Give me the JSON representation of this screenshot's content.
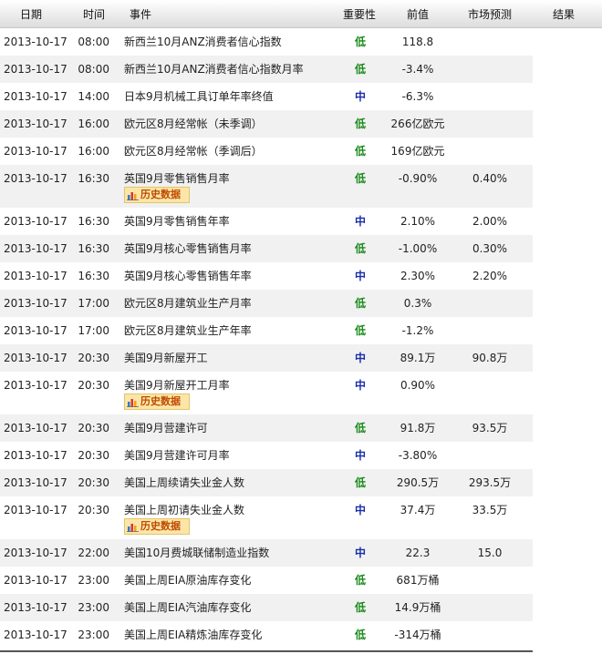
{
  "columns": {
    "date": "日期",
    "time": "时间",
    "event": "事件",
    "importance": "重要性",
    "previous": "前值",
    "forecast": "市场预测",
    "result": "结果"
  },
  "history_label": "历史数据",
  "rows": [
    {
      "date": "2013-10-17",
      "time": "08:00",
      "event": "新西兰10月ANZ消费者信心指数",
      "importance": "低",
      "level": "low",
      "previous": "118.8",
      "forecast": "",
      "result": "",
      "history": false
    },
    {
      "date": "2013-10-17",
      "time": "08:00",
      "event": "新西兰10月ANZ消费者信心指数月率",
      "importance": "低",
      "level": "low",
      "previous": "-3.4%",
      "forecast": "",
      "result": "",
      "history": false
    },
    {
      "date": "2013-10-17",
      "time": "14:00",
      "event": "日本9月机械工具订单年率终值",
      "importance": "中",
      "level": "mid",
      "previous": "-6.3%",
      "forecast": "",
      "result": "",
      "history": false
    },
    {
      "date": "2013-10-17",
      "time": "16:00",
      "event": "欧元区8月经常帐（未季调）",
      "importance": "低",
      "level": "low",
      "previous": "266亿欧元",
      "forecast": "",
      "result": "",
      "history": false
    },
    {
      "date": "2013-10-17",
      "time": "16:00",
      "event": "欧元区8月经常帐（季调后）",
      "importance": "低",
      "level": "low",
      "previous": "169亿欧元",
      "forecast": "",
      "result": "",
      "history": false
    },
    {
      "date": "2013-10-17",
      "time": "16:30",
      "event": "英国9月零售销售月率",
      "importance": "低",
      "level": "low",
      "previous": "-0.90%",
      "forecast": "0.40%",
      "result": "",
      "history": true
    },
    {
      "date": "2013-10-17",
      "time": "16:30",
      "event": "英国9月零售销售年率",
      "importance": "中",
      "level": "mid",
      "previous": "2.10%",
      "forecast": "2.00%",
      "result": "",
      "history": false
    },
    {
      "date": "2013-10-17",
      "time": "16:30",
      "event": "英国9月核心零售销售月率",
      "importance": "低",
      "level": "low",
      "previous": "-1.00%",
      "forecast": "0.30%",
      "result": "",
      "history": false
    },
    {
      "date": "2013-10-17",
      "time": "16:30",
      "event": "英国9月核心零售销售年率",
      "importance": "中",
      "level": "mid",
      "previous": "2.30%",
      "forecast": "2.20%",
      "result": "",
      "history": false
    },
    {
      "date": "2013-10-17",
      "time": "17:00",
      "event": "欧元区8月建筑业生产月率",
      "importance": "低",
      "level": "low",
      "previous": "0.3%",
      "forecast": "",
      "result": "",
      "history": false
    },
    {
      "date": "2013-10-17",
      "time": "17:00",
      "event": "欧元区8月建筑业生产年率",
      "importance": "低",
      "level": "low",
      "previous": "-1.2%",
      "forecast": "",
      "result": "",
      "history": false
    },
    {
      "date": "2013-10-17",
      "time": "20:30",
      "event": "美国9月新屋开工",
      "importance": "中",
      "level": "mid",
      "previous": "89.1万",
      "forecast": "90.8万",
      "result": "",
      "history": false
    },
    {
      "date": "2013-10-17",
      "time": "20:30",
      "event": "美国9月新屋开工月率",
      "importance": "中",
      "level": "mid",
      "previous": "0.90%",
      "forecast": "",
      "result": "",
      "history": true
    },
    {
      "date": "2013-10-17",
      "time": "20:30",
      "event": "美国9月营建许可",
      "importance": "低",
      "level": "low",
      "previous": "91.8万",
      "forecast": "93.5万",
      "result": "",
      "history": false
    },
    {
      "date": "2013-10-17",
      "time": "20:30",
      "event": "美国9月营建许可月率",
      "importance": "中",
      "level": "mid",
      "previous": "-3.80%",
      "forecast": "",
      "result": "",
      "history": false
    },
    {
      "date": "2013-10-17",
      "time": "20:30",
      "event": "美国上周续请失业金人数",
      "importance": "低",
      "level": "low",
      "previous": "290.5万",
      "forecast": "293.5万",
      "result": "",
      "history": false
    },
    {
      "date": "2013-10-17",
      "time": "20:30",
      "event": "美国上周初请失业金人数",
      "importance": "中",
      "level": "mid",
      "previous": "37.4万",
      "forecast": "33.5万",
      "result": "",
      "history": true
    },
    {
      "date": "2013-10-17",
      "time": "22:00",
      "event": "美国10月费城联储制造业指数",
      "importance": "中",
      "level": "mid",
      "previous": "22.3",
      "forecast": "15.0",
      "result": "",
      "history": false
    },
    {
      "date": "2013-10-17",
      "time": "23:00",
      "event": "美国上周EIA原油库存变化",
      "importance": "低",
      "level": "low",
      "previous": "681万桶",
      "forecast": "",
      "result": "",
      "history": false
    },
    {
      "date": "2013-10-17",
      "time": "23:00",
      "event": "美国上周EIA汽油库存变化",
      "importance": "低",
      "level": "low",
      "previous": "14.9万桶",
      "forecast": "",
      "result": "",
      "history": false
    },
    {
      "date": "2013-10-17",
      "time": "23:00",
      "event": "美国上周EIA精炼油库存变化",
      "importance": "低",
      "level": "low",
      "previous": "-314万桶",
      "forecast": "",
      "result": "",
      "history": false
    }
  ],
  "colors": {
    "importance_low": "#1a8a1a",
    "importance_mid": "#1a2faa",
    "row_alt_background": "#f1f1f1",
    "history_button_background": "#fbe6a8",
    "history_button_text": "#c04a00"
  }
}
